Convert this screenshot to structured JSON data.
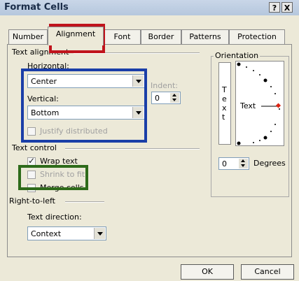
{
  "window": {
    "title": "Format Cells",
    "help_label": "?",
    "close_label": "X"
  },
  "tabs": [
    {
      "label": "Number",
      "active": false
    },
    {
      "label": "Alignment",
      "active": true
    },
    {
      "label": "Font",
      "active": false
    },
    {
      "label": "Border",
      "active": false
    },
    {
      "label": "Patterns",
      "active": false
    },
    {
      "label": "Protection",
      "active": false
    }
  ],
  "text_alignment": {
    "group_label": "Text alignment",
    "horizontal_label": "Horizontal:",
    "horizontal_value": "Center",
    "indent_label": "Indent:",
    "indent_value": "0",
    "vertical_label": "Vertical:",
    "vertical_value": "Bottom",
    "justify_label": "Justify distributed"
  },
  "text_control": {
    "group_label": "Text control",
    "wrap_label": "Wrap text",
    "wrap_checked": true,
    "shrink_label": "Shrink to fit",
    "shrink_checked": false,
    "merge_label": "Merge cells",
    "merge_checked": false
  },
  "right_to_left": {
    "group_label": "Right-to-left",
    "direction_label": "Text direction:",
    "direction_value": "Context"
  },
  "orientation": {
    "group_label": "Orientation",
    "vertical_text": [
      "T",
      "e",
      "x",
      "t"
    ],
    "dial_text": "Text",
    "degrees_value": "0",
    "degrees_label": "Degrees"
  },
  "buttons": {
    "ok": "OK",
    "cancel": "Cancel"
  },
  "highlights": {
    "red": "#c0141c",
    "blue": "#1a3ea8",
    "green": "#2e6b1a"
  }
}
